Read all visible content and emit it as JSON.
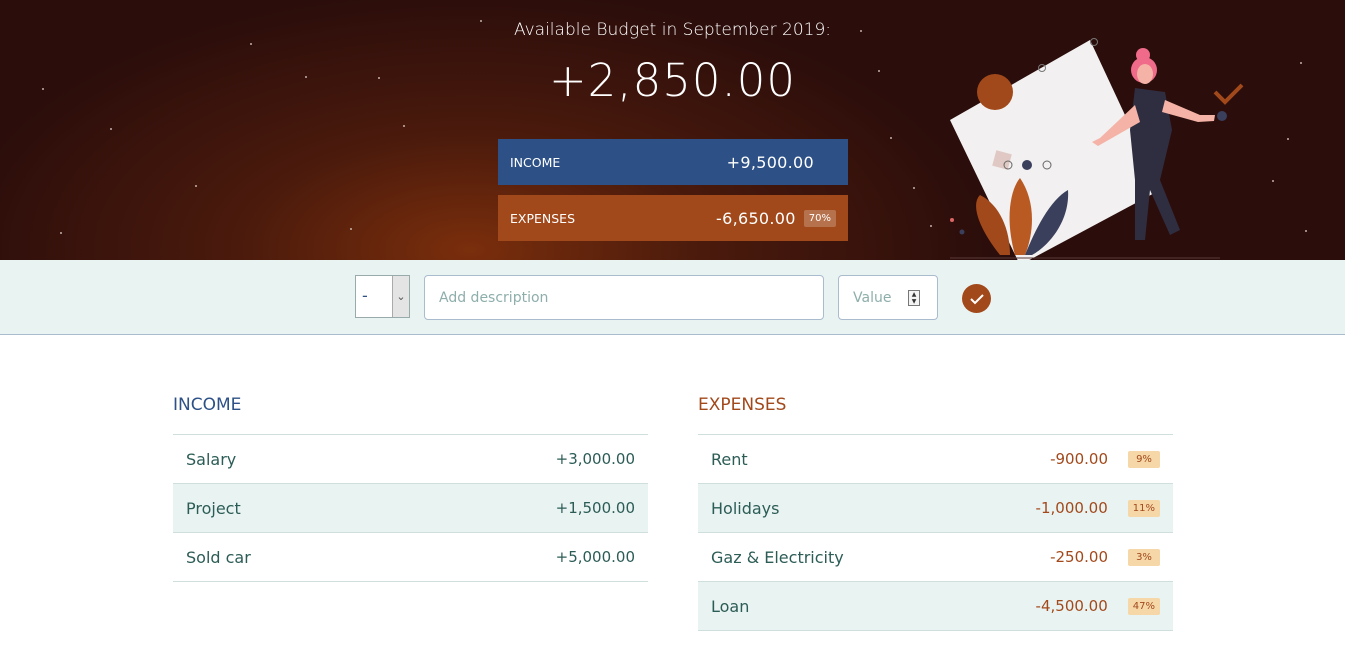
{
  "header": {
    "title": "Available Budget in September 2019:",
    "budget": "+2,850.00",
    "income": {
      "label": "INCOME",
      "value": "+9,500.00"
    },
    "expenses": {
      "label": "EXPENSES",
      "value": "-6,650.00",
      "percentage": "70%"
    }
  },
  "add_bar": {
    "type_selected": "-",
    "description_placeholder": "Add description",
    "value_placeholder": "Value",
    "submit_icon": "checkmark-icon"
  },
  "income_list": {
    "title": "INCOME",
    "items": [
      {
        "description": "Salary",
        "value": "+3,000.00"
      },
      {
        "description": "Project",
        "value": "+1,500.00"
      },
      {
        "description": "Sold car",
        "value": "+5,000.00"
      }
    ]
  },
  "expenses_list": {
    "title": "EXPENSES",
    "items": [
      {
        "description": "Rent",
        "value": "-900.00",
        "percentage": "9%"
      },
      {
        "description": "Holidays",
        "value": "-1,000.00",
        "percentage": "11%"
      },
      {
        "description": "Gaz & Electricity",
        "value": "-250.00",
        "percentage": "3%"
      },
      {
        "description": "Loan",
        "value": "-4,500.00",
        "percentage": "47%"
      }
    ]
  },
  "colors": {
    "income": "#2d5186",
    "expenses": "#a2491b",
    "row_alt": "#e9f3f2",
    "percentage_badge": "#f5d7a8"
  }
}
